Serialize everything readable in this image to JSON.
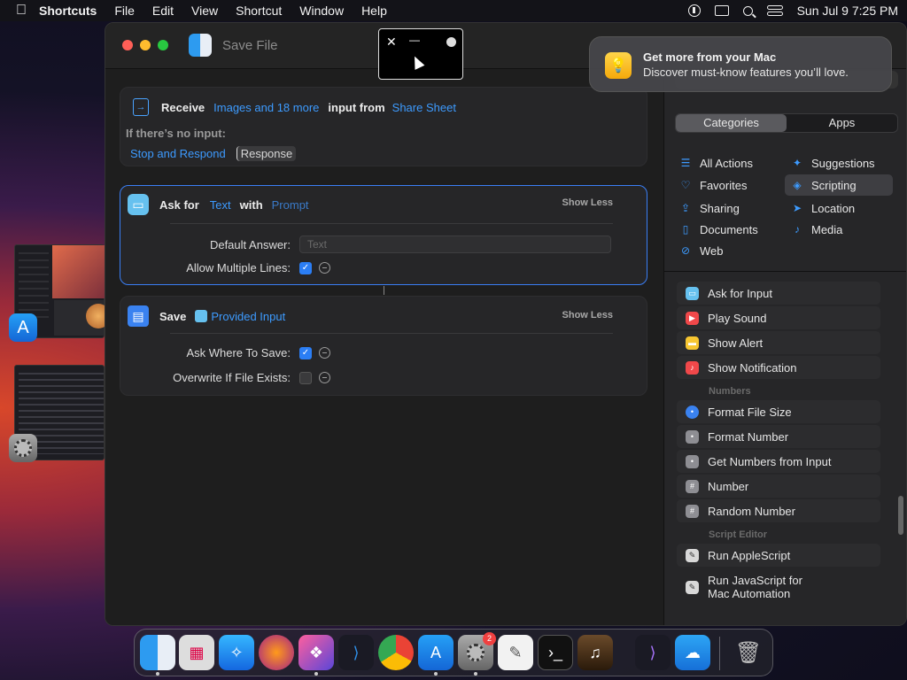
{
  "menubar": {
    "apple": "",
    "app_name": "Shortcuts",
    "items": [
      "File",
      "Edit",
      "View",
      "Shortcut",
      "Window",
      "Help"
    ],
    "datetime": "Sun Jul 9  7:25 PM"
  },
  "window": {
    "title": "Save File"
  },
  "receive_card": {
    "receive": "Receive",
    "types": "Images and 18 more",
    "input_from": "input from",
    "source": "Share Sheet",
    "no_input": "If there’s no input:",
    "stop_respond": "Stop and Respond",
    "response": "Response"
  },
  "ask_card": {
    "ask_for": "Ask for",
    "type": "Text",
    "with": "with",
    "prompt": "Prompt",
    "show_less": "Show Less",
    "default_answer_label": "Default Answer:",
    "default_answer_placeholder": "Text",
    "allow_multiple_label": "Allow Multiple Lines:"
  },
  "save_card": {
    "save": "Save",
    "input": "Provided Input",
    "show_less": "Show Less",
    "ask_where_label": "Ask Where To Save:",
    "overwrite_label": "Overwrite If File Exists:"
  },
  "sidebar": {
    "tabs": [
      "Categories",
      "Apps"
    ],
    "categories": [
      {
        "label": "All Actions",
        "icon": "list-icon"
      },
      {
        "label": "Suggestions",
        "icon": "sparkle-icon"
      },
      {
        "label": "Favorites",
        "icon": "heart-icon"
      },
      {
        "label": "Scripting",
        "icon": "scripting-icon"
      },
      {
        "label": "Sharing",
        "icon": "share-icon"
      },
      {
        "label": "Location",
        "icon": "location-icon"
      },
      {
        "label": "Documents",
        "icon": "document-icon"
      },
      {
        "label": "Media",
        "icon": "music-icon"
      },
      {
        "label": "Web",
        "icon": "compass-icon"
      }
    ],
    "sections": {
      "numbers": "Numbers",
      "script_editor": "Script Editor"
    },
    "items": {
      "ask_for_input": "Ask for Input",
      "play_sound": "Play Sound",
      "show_alert": "Show Alert",
      "show_notification": "Show Notification",
      "format_file_size": "Format File Size",
      "format_number": "Format Number",
      "get_numbers": "Get Numbers from Input",
      "number": "Number",
      "random_number": "Random Number",
      "run_applescript": "Run AppleScript",
      "run_js": "Run JavaScript for Mac Automation"
    }
  },
  "notification": {
    "title": "Get more from your Mac",
    "body": "Discover must-know features you’ll love."
  },
  "dock": {
    "settings_badge": "2"
  },
  "colors": {
    "accent": "#3d9bff",
    "selected_border": "#3a7ef5"
  }
}
